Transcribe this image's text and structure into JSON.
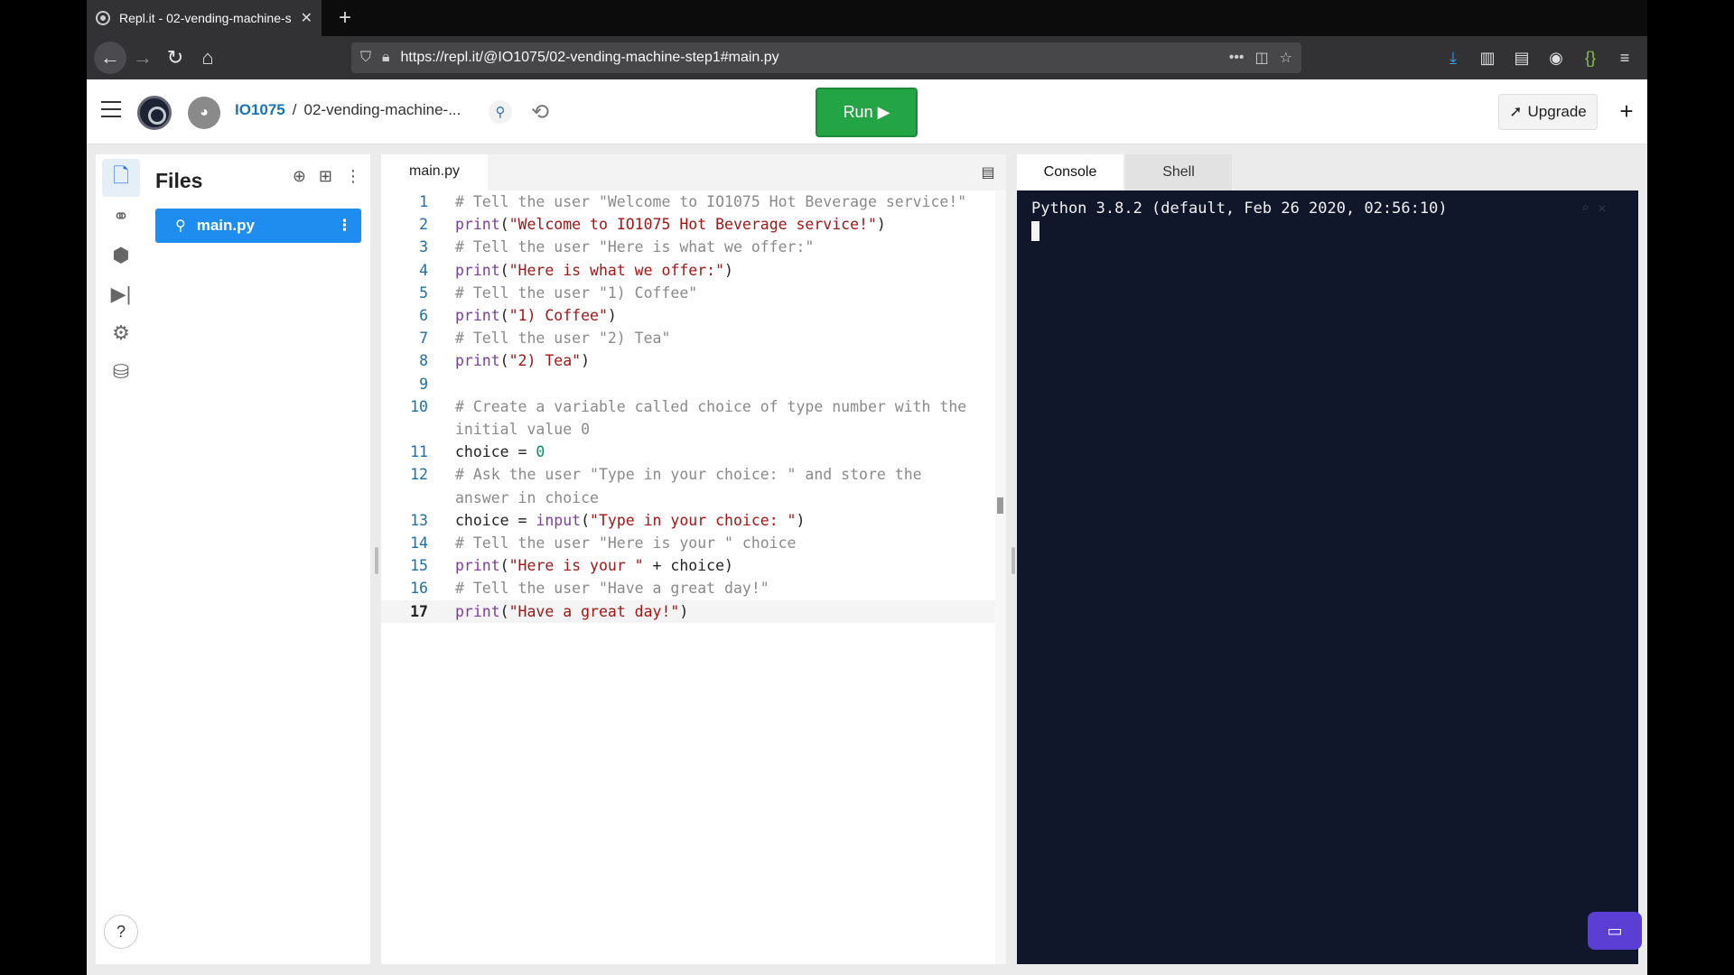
{
  "browser": {
    "tab_title": "Repl.it - 02-vending-machine-s",
    "url": "https://repl.it/@IO1075/02-vending-machine-step1#main.py"
  },
  "header": {
    "user": "IO1075",
    "separator": "/",
    "project": "02-vending-machine-...",
    "run_label": "Run ▶",
    "upgrade_label": "Upgrade",
    "plus": "+"
  },
  "files": {
    "title": "Files",
    "items": [
      {
        "name": "main.py"
      }
    ]
  },
  "editor": {
    "tab": "main.py",
    "lines": [
      {
        "n": "1",
        "html": "<span class=\"cm\"># Tell the user \"Welcome to IO1075 Hot Beverage service!\"</span>"
      },
      {
        "n": "2",
        "html": "<span class=\"kw\">print</span>(<span class=\"st\">\"Welcome to IO1075 Hot Beverage service!\"</span>)"
      },
      {
        "n": "3",
        "html": "<span class=\"cm\"># Tell the user \"Here is what we offer:\"</span>"
      },
      {
        "n": "4",
        "html": "<span class=\"kw\">print</span>(<span class=\"st\">\"Here is what we offer:\"</span>)"
      },
      {
        "n": "5",
        "html": "<span class=\"cm\"># Tell the user \"1) Coffee\"</span>"
      },
      {
        "n": "6",
        "html": "<span class=\"kw\">print</span>(<span class=\"st\">\"1) Coffee\"</span>)"
      },
      {
        "n": "7",
        "html": "<span class=\"cm\"># Tell the user \"2) Tea\"</span>"
      },
      {
        "n": "8",
        "html": "<span class=\"kw\">print</span>(<span class=\"st\">\"2) Tea\"</span>)"
      },
      {
        "n": "9",
        "html": ""
      },
      {
        "n": "10",
        "html": "<span class=\"cm\"># Create a variable called choice of type number with the</span>"
      },
      {
        "n": "",
        "html": "<span class=\"cm\">initial value 0</span>"
      },
      {
        "n": "11",
        "html": "choice = <span class=\"nu\">0</span>"
      },
      {
        "n": "12",
        "html": "<span class=\"cm\"># Ask the user \"Type in your choice: \" and store the</span>"
      },
      {
        "n": "",
        "html": "<span class=\"cm\">answer in choice</span>"
      },
      {
        "n": "13",
        "html": "choice = <span class=\"kw\">input</span>(<span class=\"st\">\"Type in your choice: \"</span>)"
      },
      {
        "n": "14",
        "html": "<span class=\"cm\"># Tell the user \"Here is your \" choice</span>"
      },
      {
        "n": "15",
        "html": "<span class=\"kw\">print</span>(<span class=\"st\">\"Here is your \"</span> + choice)"
      },
      {
        "n": "16",
        "html": "<span class=\"cm\"># Tell the user \"Have a great day!\"</span>"
      },
      {
        "n": "17",
        "html": "<span class=\"kw\">print</span>(<span class=\"st\">\"Have a great day!\"</span>)",
        "active": true
      }
    ]
  },
  "console": {
    "tabs": [
      "Console",
      "Shell"
    ],
    "output": "Python 3.8.2 (default, Feb 26 2020, 02:56:10)"
  },
  "icons": {
    "files": "file-icon",
    "version-control": "share-icon",
    "packages": "cube-icon",
    "debugger": "step-icon",
    "settings": "gear-icon",
    "database": "database-icon"
  },
  "colors": {
    "run": "#23a545",
    "active_file": "#1f8cf0",
    "console_bg": "#10172a"
  }
}
